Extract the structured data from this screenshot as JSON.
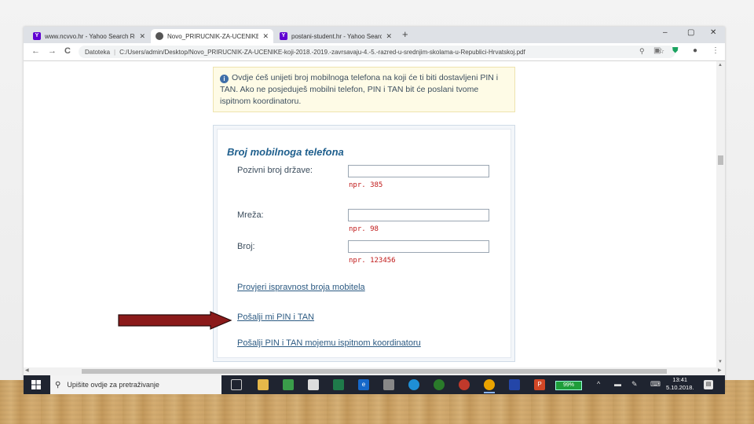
{
  "browser": {
    "tabs": [
      {
        "title": "www.ncvvo.hr - Yahoo Search Re",
        "favicon": "yahoo-icon",
        "active": false
      },
      {
        "title": "Novo_PRIRUCNIK-ZA-UCENIKE-k",
        "favicon": "globe-icon",
        "active": true
      },
      {
        "title": "postani-student.hr - Yahoo Searc",
        "favicon": "yahoo-icon",
        "active": false
      }
    ],
    "new_tab_glyph": "+",
    "window_controls": {
      "minimize": "–",
      "maximize": "▢",
      "close": "✕"
    },
    "nav": {
      "back": "←",
      "forward": "→",
      "reload": "C"
    },
    "address": {
      "scheme_label": "Datoteka",
      "separator": "|",
      "path": "C:/Users/admin/Desktop/Novo_PRIRUCNIK-ZA-UCENIKE-koji-2018.-2019.-zavrsavaju-4.-5.-razred-u-srednjim-skolama-u-Republici-Hrvatskoj.pdf"
    }
  },
  "page": {
    "info_text": "Ovdje ćeš unijeti broj mobilnoga telefona na koji će ti biti dostavljeni PIN i TAN. Ako ne posjeduješ mobilni telefon, PIN i TAN bit će poslani tvome ispitnom koordinatoru.",
    "panel_title": "Broj mobilnoga telefona",
    "fields": [
      {
        "label": "Pozivni broj države:",
        "value": "",
        "hint": "npr. 385"
      },
      {
        "label": "Mreža:",
        "value": "",
        "hint": "npr. 98"
      },
      {
        "label": "Broj:",
        "value": "",
        "hint": "npr. 123456"
      }
    ],
    "links": {
      "verify": "Provjeri ispravnost broja mobitela",
      "send_me": "Pošalji mi PIN i TAN",
      "send_coordinator": "Pošalji PIN i TAN mojemu ispitnom koordinatoru"
    },
    "arrow_color": "#8b1a1a"
  },
  "taskbar": {
    "search_placeholder": "Upišite ovdje za pretraživanje",
    "battery": "99%",
    "time": "13:41",
    "date": "5.10.2018."
  }
}
